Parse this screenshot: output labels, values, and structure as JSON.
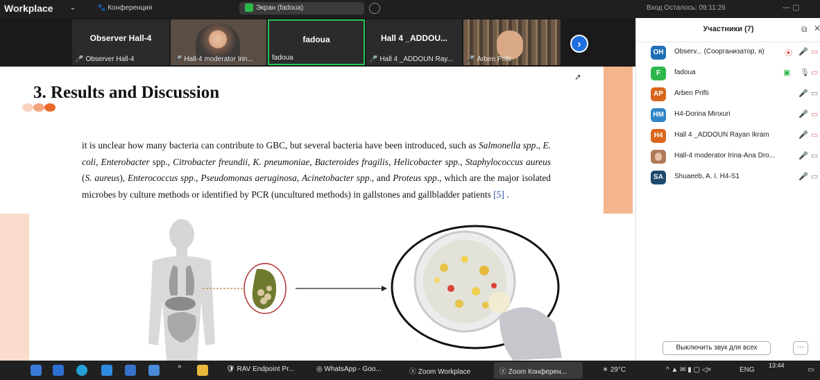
{
  "topbar": {
    "app_name": "Workplace",
    "conference_label": "Конференция",
    "share_label": "Экран (fadoua)",
    "login_label": "Вход",
    "remaining_label": "Осталось: 09:11:26"
  },
  "video_strip": {
    "tiles": [
      {
        "big": "Observer Hall-4",
        "name": "Observer Hall-4"
      },
      {
        "big": "",
        "name": "Hall-4 moderator Irin..."
      },
      {
        "big": "fadoua",
        "name": "fadoua"
      },
      {
        "big": "Hall 4 _ADDOU...",
        "name": "Hall 4 _ADDOUN Ray..."
      },
      {
        "big": "",
        "name": "Arben Prifti"
      }
    ],
    "next_glyph": "›"
  },
  "slide": {
    "title": "3. Results and Discussion",
    "paragraph": {
      "p1": "it is unclear how many bacteria can contribute to GBC, but several bacteria have been introduced, such as ",
      "i1": "Salmonella spp",
      "p2": "., ",
      "i2": "E. coli",
      "p3": ", ",
      "i3": "Enterobacter",
      "p4": " spp., ",
      "i4": "Citrobacter freundii",
      "p5": ", ",
      "i5": "K. pneumoniae",
      "p6": ", ",
      "i6": "Bacteroides fragilis",
      "p7": ", ",
      "i7": "Helicobacter spp",
      "p8": "., ",
      "i8": "Staphylococcus aureus",
      "p9": " (",
      "i9": "S. aureus",
      "p10": "), ",
      "i10": "Enterococcus spp",
      "p11": "., ",
      "i11": "Pseudomonas aeruginosa",
      "p12": ", ",
      "i12": "Acinetobacter spp",
      "p13": "., and ",
      "i13": "Proteus spp",
      "p14": "., which are the major isolated microbes by culture methods or identified by PCR (uncultured methods) in gallstones and gallbladder patients ",
      "ref": "[5]",
      "p15": " ."
    },
    "dot_colors": [
      "#f9d3bf",
      "#f3a47a",
      "#e8692a"
    ]
  },
  "participants": {
    "header": "Участники (7)",
    "items": [
      {
        "initials": "OH",
        "color": "#1f6fb5",
        "name": "Observ...  (Соорганизатор, я)"
      },
      {
        "initials": "F",
        "color": "#2eb84b",
        "name": "fadoua"
      },
      {
        "initials": "AP",
        "color": "#d9661c",
        "name": "Arben Prifti"
      },
      {
        "initials": "HM",
        "color": "#2f86c6",
        "name": "H4-Dorina Minxuri"
      },
      {
        "initials": "H4",
        "color": "#d9661c",
        "name": "Hall 4 _ADDOUN Rayan Ikram"
      },
      {
        "initials": "",
        "color": "#b07a5a",
        "name": "Hall-4 moderator Irina-Ana Dro..."
      },
      {
        "initials": "SA",
        "color": "#1f4a6e",
        "name": "Shuaeeb, A. I. H4-S1"
      }
    ],
    "mute_all_label": "Выключить звук для всех",
    "more_label": "···"
  },
  "taskbar": {
    "apps": [
      {
        "label": "RAV Endpoint Pr..."
      },
      {
        "label": "WhatsApp - Goo..."
      },
      {
        "label": "Zoom Workplace"
      },
      {
        "label": "Zoom Конферен..."
      }
    ],
    "weather": "29°C",
    "lang": "ENG",
    "time": "13:44"
  }
}
